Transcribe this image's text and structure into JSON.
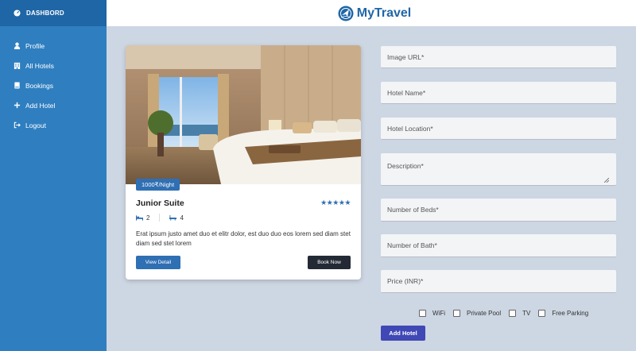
{
  "sidebar": {
    "title": "DASHBORD",
    "items": [
      {
        "label": "Profile",
        "icon": "user-icon"
      },
      {
        "label": "All Hotels",
        "icon": "building-icon"
      },
      {
        "label": "Bookings",
        "icon": "book-icon"
      },
      {
        "label": "Add Hotel",
        "icon": "plus-icon"
      },
      {
        "label": "Logout",
        "icon": "logout-icon"
      }
    ]
  },
  "header": {
    "brand": "MyTravel",
    "logo": "travel-globe-logo"
  },
  "card": {
    "price": "1000₹/Night",
    "title": "Junior Suite",
    "rating": "★★★★★",
    "beds": "2",
    "baths": "4",
    "description": "Erat ipsum justo amet duo et elitr dolor, est duo duo eos lorem sed diam stet diam sed stet lorem",
    "view_label": "View Detail",
    "book_label": "Book Now"
  },
  "form": {
    "image_url": "Image URL*",
    "hotel_name": "Hotel Name*",
    "hotel_location": "Hotel Location*",
    "description": "Description*",
    "beds": "Number of Beds*",
    "bath": "Number of Bath*",
    "price": "Price (INR)*",
    "amenities": [
      "WiFi",
      "Private Pool",
      "TV",
      "Free Parking"
    ],
    "submit_label": "Add Hotel"
  },
  "colors": {
    "sidebar": "#2f7fc0",
    "sidebar_head": "#1f66a6",
    "background": "#cdd6e3",
    "accent": "#2f6fb3",
    "submit": "#3f48b5"
  }
}
